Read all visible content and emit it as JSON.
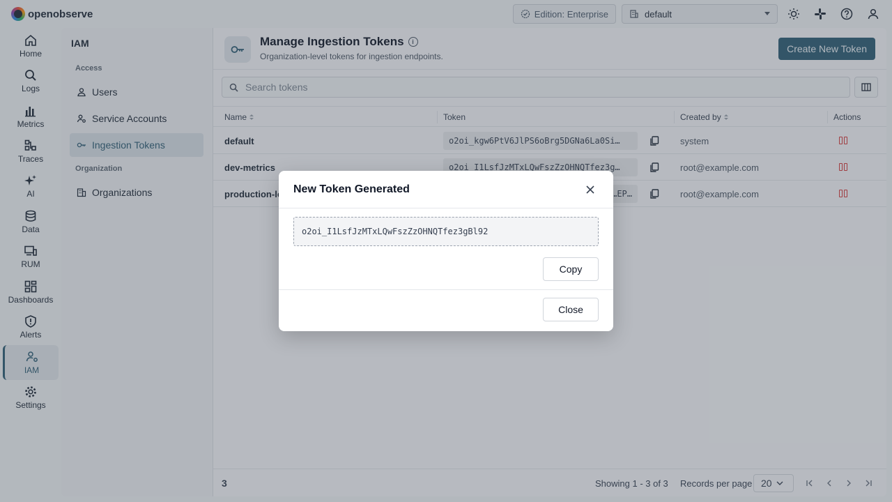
{
  "app": {
    "brand": "openobserve"
  },
  "topbar": {
    "edition_label": "Edition: Enterprise",
    "org_value": "default"
  },
  "nav": {
    "items": [
      {
        "label": "Home",
        "icon": "home-icon"
      },
      {
        "label": "Logs",
        "icon": "search-icon"
      },
      {
        "label": "Metrics",
        "icon": "bar-chart-icon"
      },
      {
        "label": "Traces",
        "icon": "traces-icon"
      },
      {
        "label": "AI",
        "icon": "sparkle-icon"
      },
      {
        "label": "Data",
        "icon": "database-icon"
      },
      {
        "label": "RUM",
        "icon": "devices-icon"
      },
      {
        "label": "Dashboards",
        "icon": "dashboard-icon"
      },
      {
        "label": "Alerts",
        "icon": "shield-alert-icon"
      },
      {
        "label": "IAM",
        "icon": "user-gear-icon"
      },
      {
        "label": "Settings",
        "icon": "gear-icon"
      }
    ],
    "active": "IAM"
  },
  "iam": {
    "title": "IAM",
    "section_access": "Access",
    "section_org": "Organization",
    "items": [
      {
        "label": "Users",
        "icon": "user-icon"
      },
      {
        "label": "Service Accounts",
        "icon": "service-account-icon"
      },
      {
        "label": "Ingestion Tokens",
        "icon": "key-icon"
      },
      {
        "label": "Organizations",
        "icon": "building-icon"
      }
    ],
    "active": "Ingestion Tokens"
  },
  "page": {
    "title": "Manage Ingestion Tokens",
    "subtitle": "Organization-level tokens for ingestion endpoints.",
    "create_button": "Create New Token",
    "search_placeholder": "Search tokens"
  },
  "table": {
    "columns": [
      "Name",
      "Token",
      "Created by",
      "Actions"
    ],
    "rows": [
      {
        "name": "default",
        "token": "o2oi_kgw6PtV6JlPS6oBrg5DGNa6La0Si…",
        "created_by": "system"
      },
      {
        "name": "dev-metrics",
        "token": "o2oi_I1LsfJzMTxLQwFszZzOHNQTfez3g…",
        "created_by": "root@example.com"
      },
      {
        "name": "production-lo",
        "token": "…EP…",
        "created_by": "root@example.com"
      }
    ]
  },
  "footer": {
    "count": "3",
    "showing": "Showing 1 - 3 of 3",
    "records_per_page_label": "Records per page",
    "records_per_page_value": "20"
  },
  "dialog": {
    "title": "New Token Generated",
    "token": "o2oi_I1LsfJzMTxLQwFszZzOHNQTfez3gBl92",
    "copy_button": "Copy",
    "close_button": "Close"
  },
  "colors": {
    "accent": "#2f5d73",
    "danger": "#d13a3a"
  }
}
